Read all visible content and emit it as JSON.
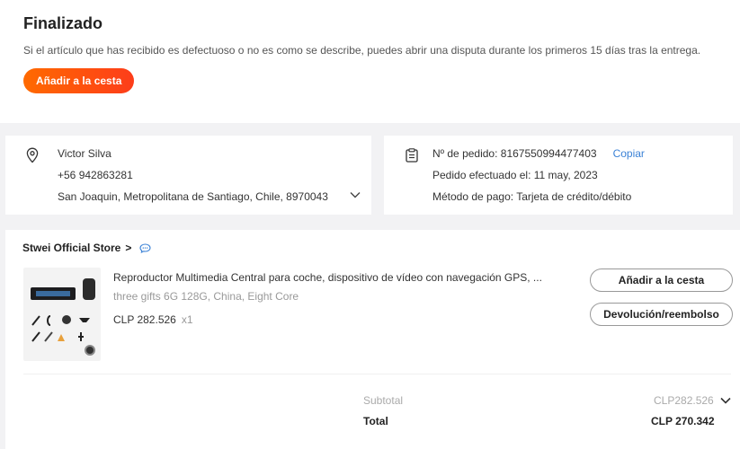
{
  "status": {
    "title": "Finalizado",
    "message": "Si el artículo que has recibido es defectuoso o no es como se describe, puedes abrir una disputa durante los primeros 15 días tras la entrega.",
    "add_to_cart_label": "Añadir a la cesta",
    "accent": "#ff6a00"
  },
  "address": {
    "name": "Victor Silva",
    "phone": "+56 942863281",
    "location": "San Joaquin, Metropolitana de Santiago, Chile, 8970043"
  },
  "order": {
    "number": "Nº de pedido: 8167550994477403",
    "copy_label": "Copiar",
    "date": "Pedido efectuado el: 11 may, 2023",
    "payment": "Método de pago: Tarjeta de crédito/débito",
    "link_color": "#3b82d6"
  },
  "store": {
    "name": "Stwei Official Store",
    "arrow": ">",
    "item": {
      "title": "Reproductor Multimedia Central para coche, dispositivo de vídeo con navegación GPS, ...",
      "variant": "three gifts 6G 128G, China, Eight Core",
      "price": "CLP 282.526",
      "quantity": "x1"
    },
    "add_to_cart_label": "Añadir a la cesta",
    "refund_label": "Devolución/reembolso",
    "subtotal_label": "Subtotal",
    "subtotal_value": "CLP282.526",
    "total_label": "Total",
    "total_value": "CLP 270.342"
  }
}
